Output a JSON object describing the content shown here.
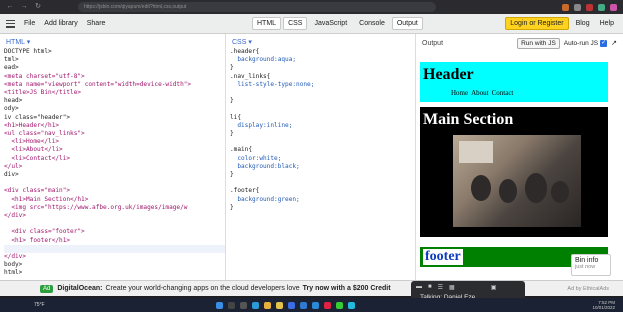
{
  "browser": {
    "url": "https://jsbin.com/qiyapum/edit?html,css,output"
  },
  "toolbar": {
    "file_label": "File",
    "add_library_label": "Add library",
    "share_label": "Share",
    "tabs": [
      {
        "label": "HTML",
        "active": true
      },
      {
        "label": "CSS",
        "active": true
      },
      {
        "label": "JavaScript",
        "active": false
      },
      {
        "label": "Console",
        "active": false
      },
      {
        "label": "Output",
        "active": true
      }
    ],
    "login_label": "Login or Register",
    "blog_label": "Blog",
    "help_label": "Help"
  },
  "html_panel": {
    "label": "HTML ▾",
    "lines": [
      "DOCTYPE html>",
      "tml>",
      "ead>",
      "<meta charset=\"utf-8\">",
      "<meta name=\"viewport\" content=\"width=device-width\">",
      "<title>JS Bin</title>",
      "head>",
      "ody>",
      "iv class=\"header\">",
      "<h1>Header</h1>",
      "<ul class=\"nav_links\">",
      "  <li>Home</li>",
      "  <li>About</li>",
      "  <li>Contact</li>",
      "</ul>",
      "div>",
      "",
      "<div class=\"main\">",
      "  <h1>Main Section</h1>",
      "  <img src=\"https://www.afbe.org.uk/images/image/w",
      "</div>",
      "",
      "  <div class=\"footer\">",
      "  <h1> footer</h1>",
      "",
      "</div>",
      "body>",
      "html>"
    ]
  },
  "css_panel": {
    "label": "CSS ▾",
    "lines": [
      ".header{",
      "  background:aqua;",
      "}",
      ".nav_links{",
      "  list-style-type:none;",
      "",
      "}",
      "",
      "li{",
      "  display:inline;",
      "}",
      "",
      ".main{",
      "  color:white;",
      "  background:black;",
      "}",
      "",
      ".footer{",
      "  background:green;",
      "}"
    ]
  },
  "output_panel": {
    "label": "Output",
    "run_label": "Run with JS",
    "auto_run_label": "Auto-run JS",
    "auto_run_checked": true
  },
  "render": {
    "header_title": "Header",
    "nav": [
      "Home",
      "About",
      "Contact"
    ],
    "main_title": "Main Section",
    "footer_title": "footer",
    "colors": {
      "header_bg": "#00ffff",
      "main_bg": "#000000",
      "footer_bg": "#008000"
    }
  },
  "bin_info": {
    "title": "Bin info",
    "subtitle": "just now"
  },
  "ad": {
    "badge": "Ad",
    "brand": "DigitalOcean:",
    "text": "Create your world-changing apps on the cloud developers love",
    "cta": "Try now with a $200 Credit",
    "by": "Ad by EthicalAds"
  },
  "meeting": {
    "talking": "Talking: Daniel Eze"
  },
  "taskbar": {
    "weather": "75°F",
    "time": "7:52 PM",
    "date": "10/01/2022"
  }
}
